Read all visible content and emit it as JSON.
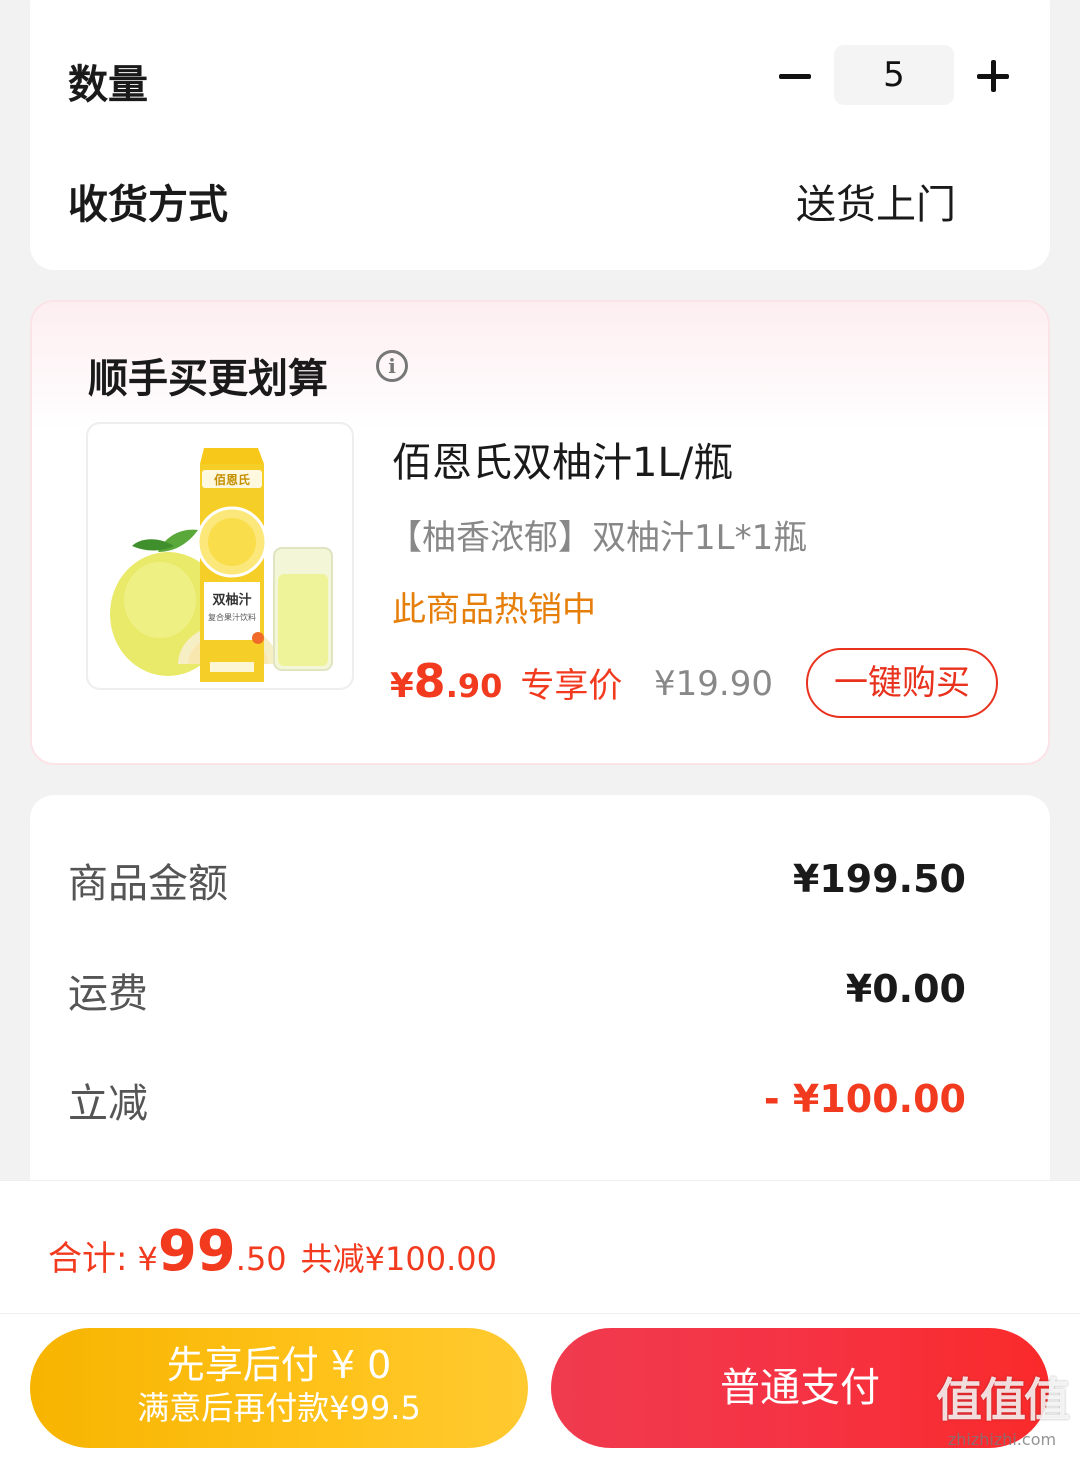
{
  "order": {
    "quantity_label": "数量",
    "quantity_value": "5",
    "delivery_label": "收货方式",
    "delivery_value": "送货上门"
  },
  "upsell": {
    "title": "顺手买更划算",
    "info_icon": "info-circle-icon",
    "product": {
      "name": "佰恩氏双柚汁1L/瓶",
      "spec": "【柚香浓郁】双柚汁1L*1瓶",
      "hot_text": "此商品热销中",
      "price_symbol": "¥",
      "price_int": "8",
      "price_dec": ".90",
      "price_tag": "专享价",
      "original_price": "¥19.90",
      "buy_label": "一键购买",
      "image_label": "佰恩氏",
      "image_sub": "双柚汁"
    }
  },
  "summary": {
    "goods_label": "商品金额",
    "goods_value": "¥199.50",
    "shipping_label": "运费",
    "shipping_value": "¥0.00",
    "discount_label": "立减",
    "discount_value": "- ¥100.00"
  },
  "bottom": {
    "total_label": "合计:",
    "total_symbol": "¥",
    "total_int": "99",
    "total_dec": ".50",
    "total_saved": "共减¥100.00",
    "paylater_main": "先享后付 ¥ 0",
    "paylater_sub": "满意后再付款¥99.5",
    "pay_label": "普通支付"
  },
  "watermark": {
    "logo": "值值值",
    "url": "zhizhizhi.com"
  },
  "colors": {
    "accent_red": "#f23a1f",
    "hot_orange": "#e67e0a",
    "paylater_yellow": "#ffc21a",
    "pay_red": "#f53344"
  }
}
